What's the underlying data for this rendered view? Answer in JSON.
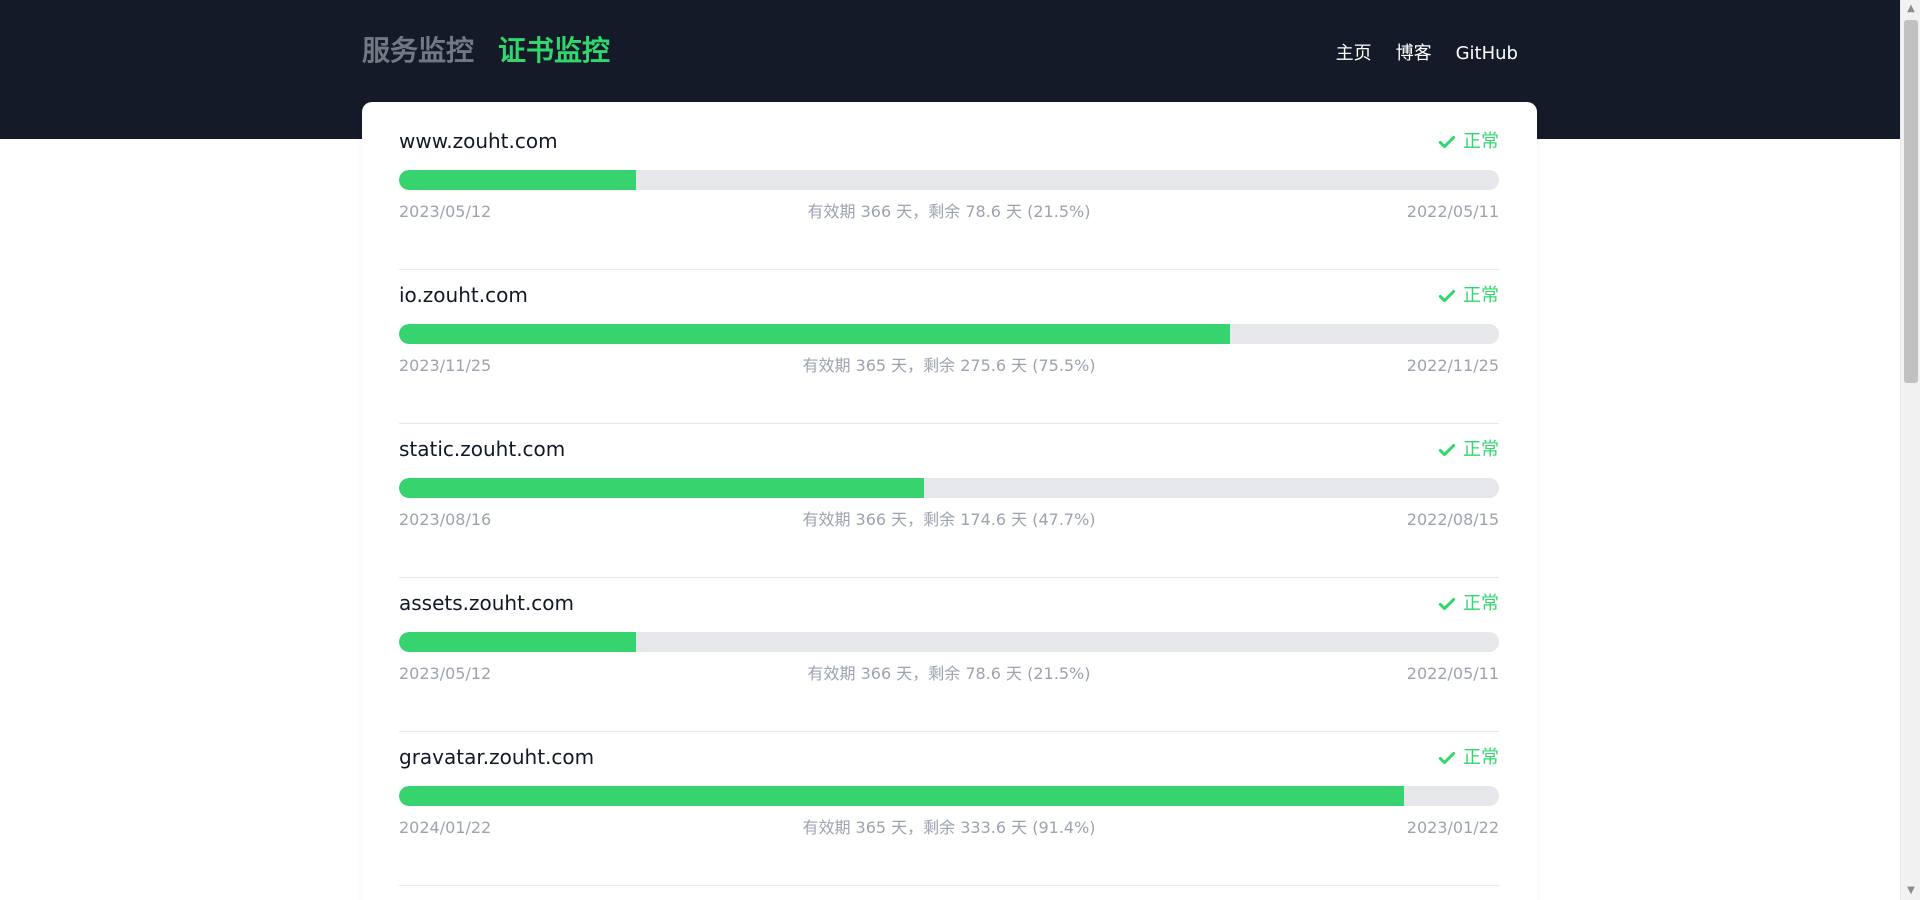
{
  "header": {
    "brand_links": [
      {
        "label": "服务监控",
        "color": "#727781"
      },
      {
        "label": "证书监控",
        "color": "#2fd76d"
      }
    ],
    "nav_links": [
      "主页",
      "博客",
      "GitHub"
    ],
    "background": "#141a28"
  },
  "theme": {
    "accent": "#37d36f",
    "status_color": "#2fd76d",
    "track_color": "#e5e7eb",
    "meta_color": "#9ca3af"
  },
  "certificates": [
    {
      "domain": "www.zouht.com",
      "status": "正常",
      "status_icon": "check-icon",
      "start_date": "2023/05/12",
      "summary": "有效期 366 天，剩余 78.6 天 (21.5%)",
      "end_date": "2022/05/11",
      "remaining_percent": 21.5
    },
    {
      "domain": "io.zouht.com",
      "status": "正常",
      "status_icon": "check-icon",
      "start_date": "2023/11/25",
      "summary": "有效期 365 天，剩余 275.6 天 (75.5%)",
      "end_date": "2022/11/25",
      "remaining_percent": 75.5
    },
    {
      "domain": "static.zouht.com",
      "status": "正常",
      "status_icon": "check-icon",
      "start_date": "2023/08/16",
      "summary": "有效期 366 天，剩余 174.6 天 (47.7%)",
      "end_date": "2022/08/15",
      "remaining_percent": 47.7
    },
    {
      "domain": "assets.zouht.com",
      "status": "正常",
      "status_icon": "check-icon",
      "start_date": "2023/05/12",
      "summary": "有效期 366 天，剩余 78.6 天 (21.5%)",
      "end_date": "2022/05/11",
      "remaining_percent": 21.5
    },
    {
      "domain": "gravatar.zouht.com",
      "status": "正常",
      "status_icon": "check-icon",
      "start_date": "2024/01/22",
      "summary": "有效期 365 天，剩余 333.6 天 (91.4%)",
      "end_date": "2023/01/22",
      "remaining_percent": 91.4
    }
  ],
  "scrollbar": {
    "icons": [
      "arrow-up-icon",
      "arrow-down-icon"
    ]
  }
}
